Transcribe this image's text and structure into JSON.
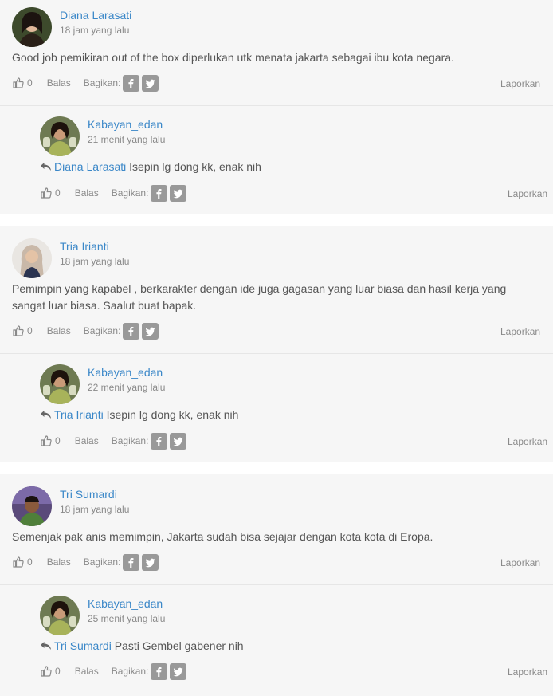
{
  "labels": {
    "balas": "Balas",
    "bagikan": "Bagikan:",
    "laporkan": "Laporkan"
  },
  "comments": [
    {
      "author": "Diana Larasati",
      "time": "18 jam yang lalu",
      "text": "Good job pemikiran out of the box diperlukan utk menata jakarta sebagai ibu kota negara.",
      "likes": "0",
      "reply": {
        "author": "Kabayan_edan",
        "time": "21 menit yang lalu",
        "reply_to": "Diana Larasati",
        "text": "Isepin lg dong kk, enak nih",
        "likes": "0"
      }
    },
    {
      "author": "Tria Irianti",
      "time": "18 jam yang lalu",
      "text": "Pemimpin yang kapabel , berkarakter dengan ide juga gagasan yang luar biasa dan hasil kerja yang sangat luar biasa. Saalut buat bapak.",
      "likes": "0",
      "reply": {
        "author": "Kabayan_edan",
        "time": "22 menit yang lalu",
        "reply_to": "Tria Irianti",
        "text": "Isepin lg dong kk, enak nih",
        "likes": "0"
      }
    },
    {
      "author": "Tri Sumardi",
      "time": "18 jam yang lalu",
      "text": "Semenjak pak anis memimpin, Jakarta sudah bisa sejajar dengan kota kota di Eropa.",
      "likes": "0",
      "reply": {
        "author": "Kabayan_edan",
        "time": "25 menit yang lalu",
        "reply_to": "Tri Sumardi",
        "text": "Pasti Gembel gabener nih",
        "likes": "0"
      }
    }
  ]
}
